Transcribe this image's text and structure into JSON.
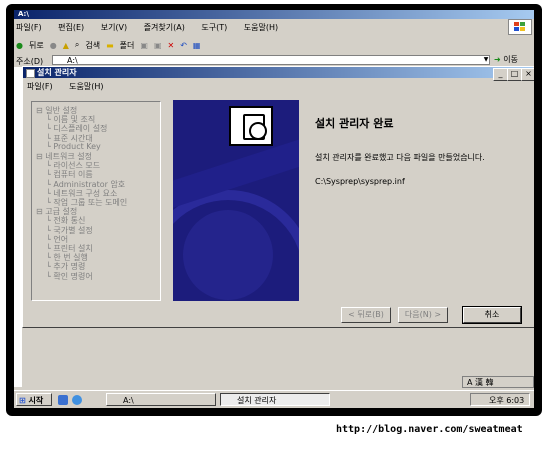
{
  "explorer": {
    "title": "A:\\",
    "menu": [
      "파일(F)",
      "편집(E)",
      "보기(V)",
      "즐겨찾기(A)",
      "도구(T)",
      "도움말(H)"
    ],
    "toolbar": {
      "back": "뒤로",
      "search": "검색",
      "folders": "폴더"
    },
    "address_label": "주소(D)",
    "address_value": "A:\\",
    "go_label": "이동"
  },
  "dialog": {
    "title": "설치 관리자",
    "menu": [
      "파일(F)",
      "도움말(H)"
    ],
    "heading": "설치 관리자 완료",
    "message": "설치 관리자를 완료했고 다음 파일을 만들었습니다.",
    "file_path": "C:\\Sysprep\\sysprep.inf",
    "buttons": {
      "back": "< 뒤로(B)",
      "next": "다음(N) >",
      "cancel": "취소"
    }
  },
  "tree": [
    {
      "label": "일반 설정",
      "level": 0
    },
    {
      "label": "이름 및 조직",
      "level": 1
    },
    {
      "label": "디스플레이 설정",
      "level": 1
    },
    {
      "label": "표준 시간대",
      "level": 1
    },
    {
      "label": "Product Key",
      "level": 1
    },
    {
      "label": "네트워크 설정",
      "level": 0
    },
    {
      "label": "라이선스 모드",
      "level": 1
    },
    {
      "label": "컴퓨터 이름",
      "level": 1
    },
    {
      "label": "Administrator 암호",
      "level": 1
    },
    {
      "label": "네트워크 구성 요소",
      "level": 1
    },
    {
      "label": "작업 그룹 또는 도메인",
      "level": 1
    },
    {
      "label": "고급 설정",
      "level": 0
    },
    {
      "label": "전화 통신",
      "level": 1
    },
    {
      "label": "국가별 설정",
      "level": 1
    },
    {
      "label": "언어",
      "level": 1
    },
    {
      "label": "프린터 설치",
      "level": 1
    },
    {
      "label": "한 번 실행",
      "level": 1
    },
    {
      "label": "추가 명령",
      "level": 1
    },
    {
      "label": "확인 명령어",
      "level": 1
    }
  ],
  "taskbar": {
    "start": "시작",
    "tasks": [
      "A:\\",
      "설치 관리자"
    ],
    "clock": "오후 6:03",
    "ime": "A 漢 韓"
  },
  "watermark": "http://blog.naver.com/sweatmeat",
  "colors": {
    "titlebar": "#0a246a",
    "desktop_blue": "#1c1c7c",
    "taskbar_task": "#1b3a8a"
  }
}
